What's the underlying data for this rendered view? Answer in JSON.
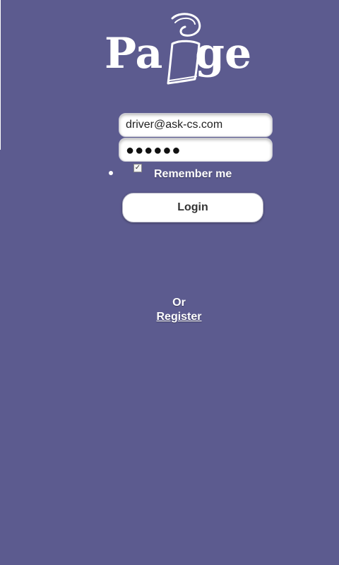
{
  "logo": {
    "text_left": "Pa",
    "text_right": "ge"
  },
  "login_form": {
    "email_value": "driver@ask-cs.com",
    "password_display": "●●●●●●",
    "remember_checked": true,
    "remember_checkmark": "✓",
    "remember_label": "Remember me",
    "login_label": "Login"
  },
  "alternative": {
    "or_text": "Or",
    "register_label": "Register"
  },
  "colors": {
    "background": "#5c5b8f",
    "text": "#ffffff"
  }
}
